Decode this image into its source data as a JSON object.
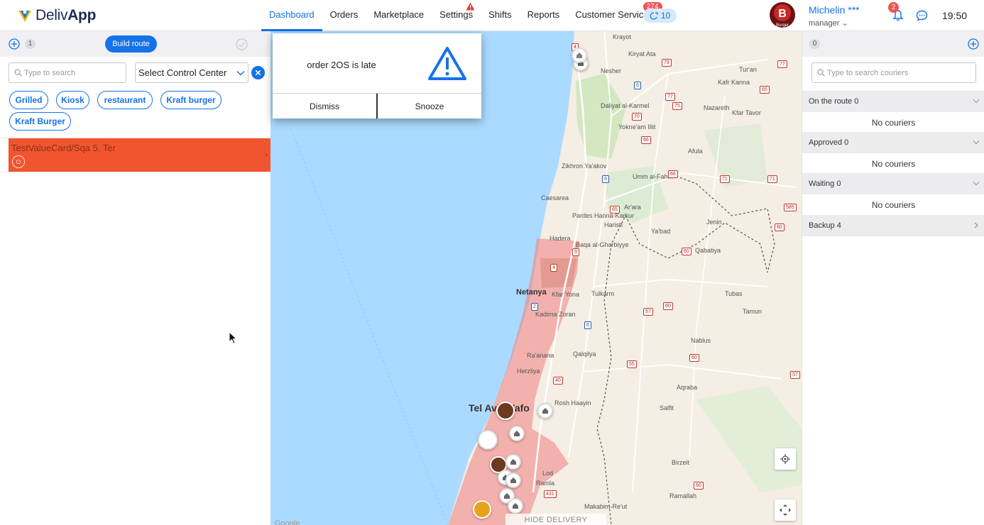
{
  "app": {
    "logo_text_light": "Deliv",
    "logo_text_bold": "App",
    "brand_color": "#1572e8",
    "alert_color": "#ef5350"
  },
  "nav": {
    "items": [
      {
        "label": "Dashboard",
        "active": true
      },
      {
        "label": "Orders"
      },
      {
        "label": "Marketplace"
      },
      {
        "label": "Settings",
        "icon": "warning-icon"
      },
      {
        "label": "Shifts"
      },
      {
        "label": "Reports"
      },
      {
        "label": "Customer Service",
        "badge": "274"
      }
    ],
    "queue_count": "10"
  },
  "user": {
    "name": "Michelin ***",
    "role": "manager",
    "avatar_letter": "B",
    "avatar_caption": "Burger",
    "notifications": "2",
    "time": "19:50"
  },
  "left_panel": {
    "route_count": "1",
    "build_route_label": "Build route",
    "search_placeholder": "Type to search",
    "control_center_placeholder": "Select Control Center",
    "tags": [
      "Grilled",
      "Kiosk",
      "restaurant",
      "Kraft burger",
      "Kraft Burger"
    ],
    "orders": [
      {
        "title": "TestValueCard/Sqa 5, Ter",
        "status_color": "#f1552f"
      }
    ]
  },
  "alert_popup": {
    "message": "order 2OS is late",
    "dismiss_label": "Dismiss",
    "snooze_label": "Snooze"
  },
  "map": {
    "hide_regions_label": "HIDE DELIVERY REGIONS",
    "google_label": "Google",
    "places": [
      "Krayot",
      "Kiryat Ata",
      "Nesher",
      "Tur'an",
      "Kafr Kanna",
      "Nazareth",
      "Daliyat al-Karmel",
      "Yokne'am Illit",
      "Kfar Tavor",
      "Afula",
      "Zikhron Ya'akov",
      "Umm al-Fahm",
      "Caesarea",
      "Pardes Hanna-Karkur",
      "Harish",
      "Ar'ara",
      "Hadera",
      "Ya'bad",
      "Jenin",
      "Baqa al-Gharbiyye",
      "Qabatiya",
      "Netanya",
      "Kfar Yona",
      "Tulkarm",
      "Tubas",
      "Kadima Zoran",
      "Tamun",
      "Qalqilya",
      "Nablus",
      "Ra'anana",
      "Herzliya",
      "Tel Aviv-Yafo",
      "Rosh Haayin",
      "Aqraba",
      "Salfit",
      "Lod",
      "Ramla",
      "Birzeit",
      "Ramallah",
      "Makabim-Re'ut"
    ],
    "region_color": "#f08080"
  },
  "right_panel": {
    "courier_count": "0",
    "search_placeholder": "Type to search couriers",
    "sections": [
      {
        "label": "On the route",
        "count": "0",
        "empty_text": "No couriers"
      },
      {
        "label": "Approved",
        "count": "0",
        "empty_text": "No couriers"
      },
      {
        "label": "Waiting",
        "count": "0",
        "empty_text": "No couriers"
      },
      {
        "label": "Backup",
        "count": "4"
      }
    ]
  }
}
